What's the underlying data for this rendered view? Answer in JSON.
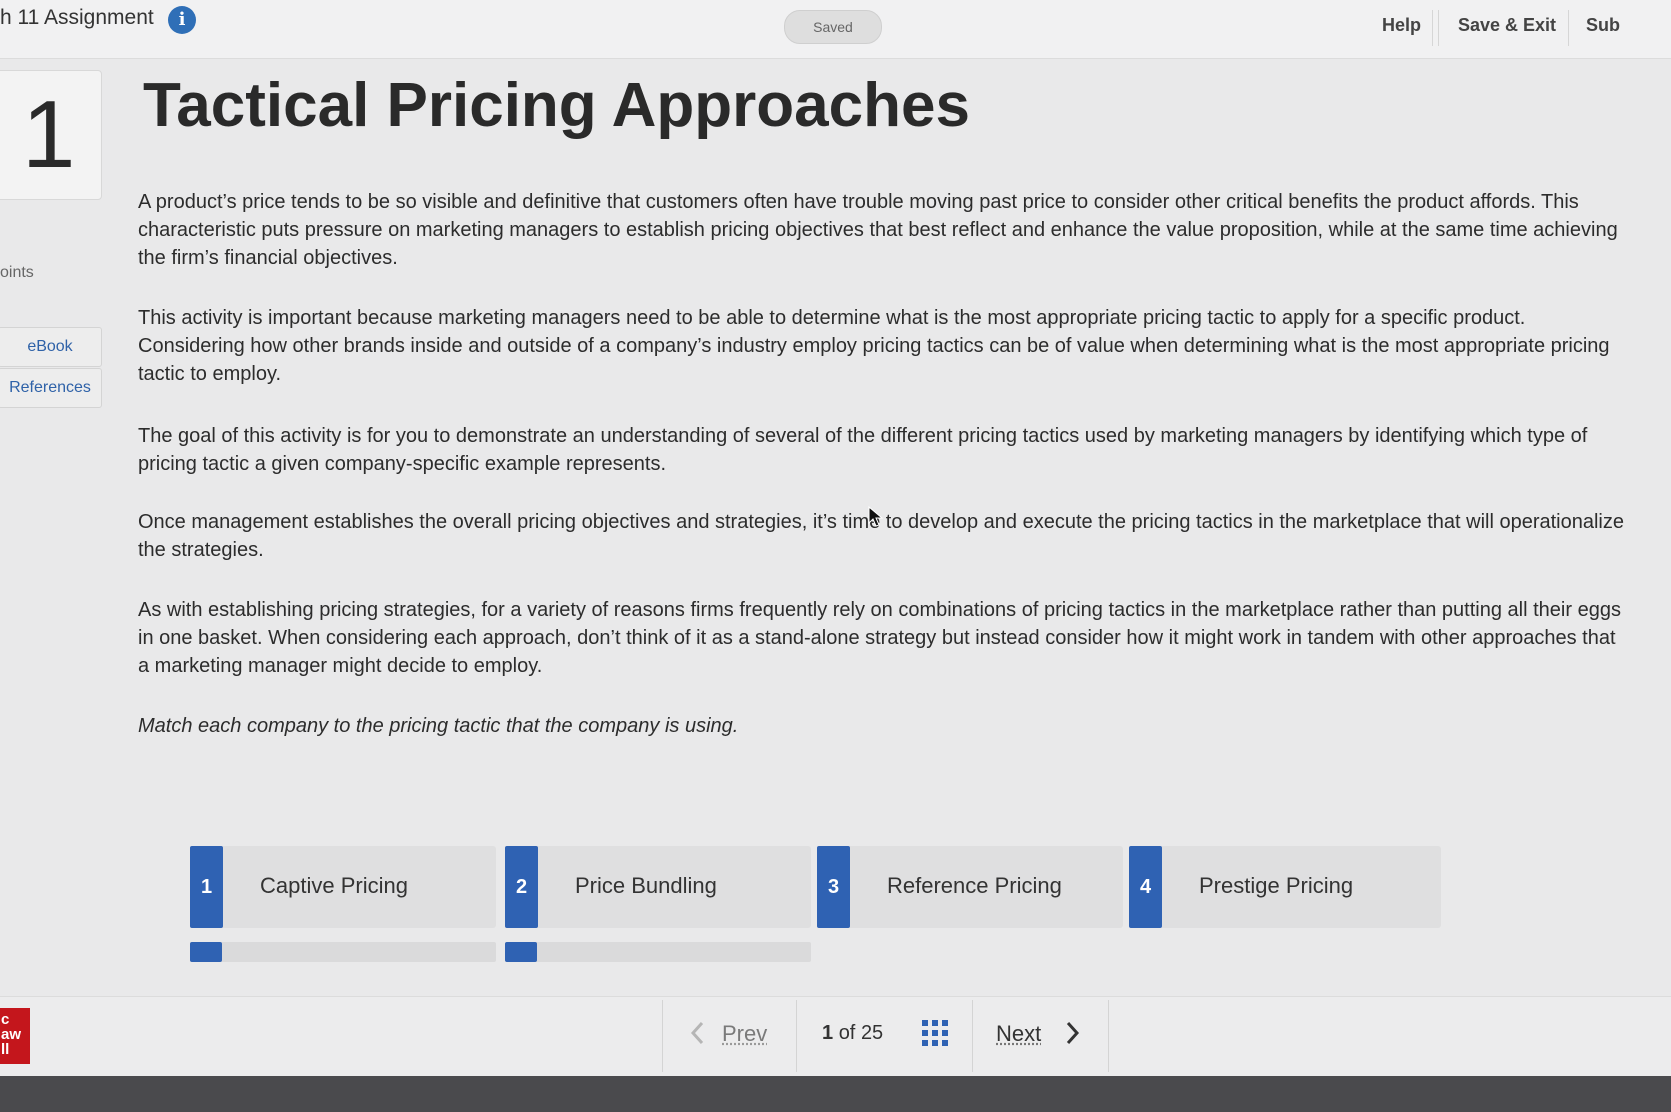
{
  "header": {
    "assignment_title": "h 11 Assignment",
    "saved_label": "Saved",
    "help_label": "Help",
    "save_exit_label": "Save & Exit",
    "submit_label": "Sub"
  },
  "sidebar": {
    "question_number": "1",
    "points_label": "oints",
    "ebook_label": "eBook",
    "references_label": "References"
  },
  "question": {
    "title": "Tactical Pricing Approaches",
    "paragraphs": [
      "A product’s price tends to be so visible and definitive that customers often have trouble moving past price to consider other critical benefits the product affords. This characteristic puts pressure on marketing managers to establish pricing objectives that best reflect and enhance the value proposition, while at the same time achieving the firm’s financial objectives.",
      "This activity is important because marketing managers need to be able to determine what is the most appropriate pricing tactic to apply for a specific product. Considering how other brands inside and outside of a company’s industry employ pricing tactics can be of value when determining what is the most appropriate pricing tactic to employ.",
      "The goal of this activity is for you to demonstrate an understanding of several of the different pricing tactics used by marketing managers by identifying which type of pricing tactic a given company-specific example represents.",
      "Once management establishes the overall pricing objectives and strategies, it’s time to develop and execute the pricing tactics in the marketplace that will operationalize the strategies.",
      "As with establishing pricing strategies, for a variety of reasons firms frequently rely on combinations of pricing tactics in the marketplace rather than putting all their eggs in one basket. When considering each approach, don’t think of it as a stand-alone strategy but instead consider how it might work in tandem with other approaches that a marketing manager might decide to employ."
    ],
    "instruction": "Match each company to the pricing tactic that the company is using."
  },
  "tactics": [
    {
      "number": "1",
      "label": "Captive Pricing"
    },
    {
      "number": "2",
      "label": "Price Bundling"
    },
    {
      "number": "3",
      "label": "Reference Pricing"
    },
    {
      "number": "4",
      "label": "Prestige Pricing"
    }
  ],
  "footer": {
    "logo_text": "c aw ll",
    "prev_label": "Prev",
    "current_page": "1",
    "of_label": "of",
    "total_pages": "25",
    "next_label": "Next"
  },
  "colors": {
    "accent_blue": "#2f62b3",
    "info_blue": "#2f6fb7",
    "logo_red": "#c4161c"
  },
  "icons": [
    "info-icon",
    "cursor-icon",
    "chevron-left-icon",
    "grid-icon",
    "chevron-right-icon"
  ]
}
